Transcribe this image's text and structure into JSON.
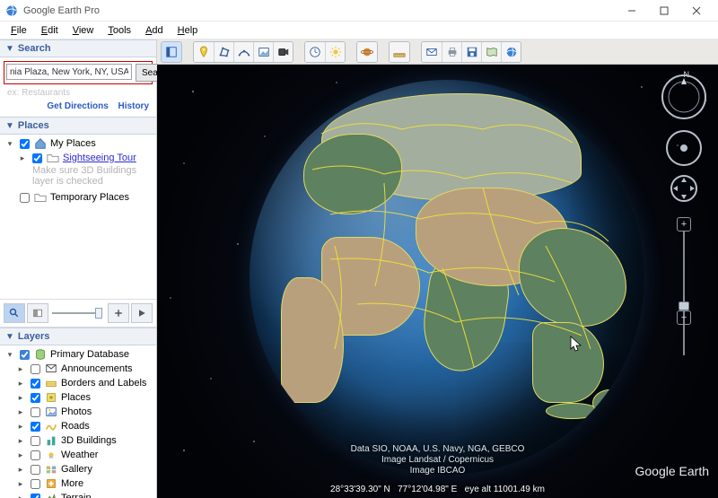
{
  "window": {
    "title": "Google Earth Pro",
    "minimize_tip": "Minimize",
    "maximize_tip": "Maximize",
    "close_tip": "Close"
  },
  "menu": [
    "File",
    "Edit",
    "View",
    "Tools",
    "Add",
    "Help"
  ],
  "sidebar": {
    "search": {
      "header": "Search",
      "value": "nia Plaza, New York, NY, USA",
      "button": "Search",
      "example_prefix": "ex:",
      "example_text": "Restaurants",
      "get_directions": "Get Directions",
      "history": "History"
    },
    "places": {
      "header": "Places",
      "my_places": "My Places",
      "tour": "Sightseeing Tour",
      "tour_hint1": "Make sure 3D Buildings",
      "tour_hint2": "layer is checked",
      "temp": "Temporary Places"
    },
    "layers": {
      "header": "Layers",
      "root": "Primary Database",
      "items": [
        {
          "label": "Announcements",
          "checked": false
        },
        {
          "label": "Borders and Labels",
          "checked": true
        },
        {
          "label": "Places",
          "checked": true
        },
        {
          "label": "Photos",
          "checked": false
        },
        {
          "label": "Roads",
          "checked": true
        },
        {
          "label": "3D Buildings",
          "checked": false
        },
        {
          "label": "Weather",
          "checked": false
        },
        {
          "label": "Gallery",
          "checked": false
        },
        {
          "label": "More",
          "checked": false
        },
        {
          "label": "Terrain",
          "checked": true
        }
      ]
    }
  },
  "toolbar": {
    "groups": [
      [
        "hide-sidebar-icon"
      ],
      [
        "placemark-icon",
        "polygon-icon",
        "path-icon",
        "image-overlay-icon",
        "record-tour-icon"
      ],
      [
        "historical-imagery-icon",
        "sunlight-icon"
      ],
      [
        "planets-icon"
      ],
      [
        "ruler-icon"
      ],
      [
        "email-icon",
        "print-icon",
        "save-image-icon",
        "view-in-maps-icon",
        "share-icon"
      ]
    ]
  },
  "map": {
    "attrib1": "Data SIO, NOAA, U.S. Navy, NGA, GEBCO",
    "attrib2": "Image Landsat / Copernicus",
    "attrib3": "Image IBCAO",
    "logo": "Google Earth",
    "north_label": "N",
    "status": {
      "lat": "28°33'39.30\" N",
      "lon": "77°12'04.98\" E",
      "eye": "eye alt 11001.49 km"
    }
  },
  "icons": {
    "sidebar_toggle": "hide-sidebar-icon",
    "search": "search-icon",
    "opacity": "opacity-icon",
    "plus": "plus-icon",
    "minus": "minus-icon"
  }
}
